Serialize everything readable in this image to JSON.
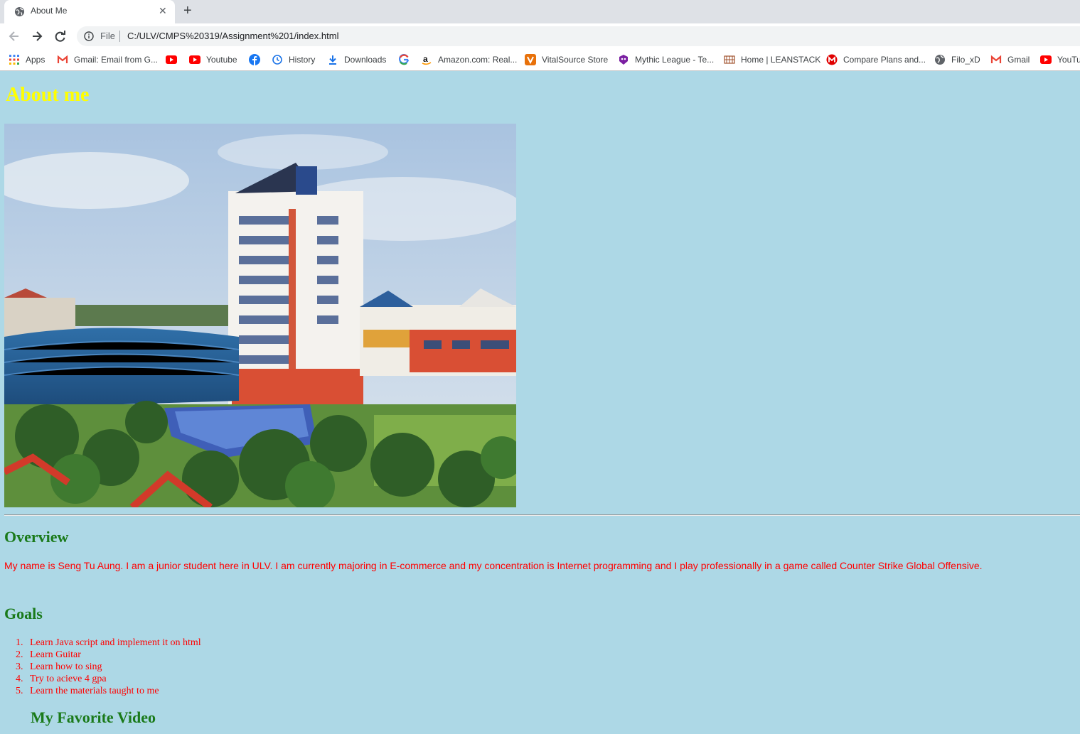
{
  "browser": {
    "tab_title": "About Me",
    "scheme_label": "File",
    "url": "C:/ULV/CMPS%20319/Assignment%201/index.html",
    "bookmarks": [
      {
        "label": "Apps",
        "icon": "apps-grid-icon"
      },
      {
        "label": "Gmail: Email from G...",
        "icon": "gmail-icon"
      },
      {
        "label": "",
        "icon": "youtube-icon"
      },
      {
        "label": "Youtube",
        "icon": "youtube-icon"
      },
      {
        "label": "",
        "icon": "facebook-icon"
      },
      {
        "label": "History",
        "icon": "history-icon"
      },
      {
        "label": "Downloads",
        "icon": "download-icon"
      },
      {
        "label": "",
        "icon": "google-icon"
      },
      {
        "label": "Amazon.com: Real...",
        "icon": "amazon-icon"
      },
      {
        "label": "VitalSource Store",
        "icon": "vitalsource-icon"
      },
      {
        "label": "Mythic League - Te...",
        "icon": "mythic-league-icon"
      },
      {
        "label": "Home | LEANSTACK",
        "icon": "leanstack-icon"
      },
      {
        "label": "Compare Plans and...",
        "icon": "compare-plans-icon"
      },
      {
        "label": "Filo_xD",
        "icon": "globe-icon"
      },
      {
        "label": "Gmail",
        "icon": "gmail-icon"
      },
      {
        "label": "YouTu",
        "icon": "youtube-icon"
      }
    ]
  },
  "page": {
    "title": "About me",
    "overview_heading": "Overview",
    "overview_text": "My name is Seng Tu Aung. I am a junior student here in ULV. I am currently majoring in E-commerce and my concentration is Internet programming and I play professionally in a game called Counter Strike Global Offensive.",
    "goals_heading": "Goals",
    "goals": [
      {
        "num": "1.",
        "text": "Learn Java script and implement it on html"
      },
      {
        "num": "2.",
        "text": "Learn Guitar"
      },
      {
        "num": "3.",
        "text": "Learn how to sing"
      },
      {
        "num": "4.",
        "text": "Try to acieve 4 gpa"
      },
      {
        "num": "5.",
        "text": "Learn the materials taught to me"
      }
    ],
    "video_heading": "My Favorite Video"
  },
  "colors": {
    "page_background": "#add8e6",
    "title_color": "#ffff00",
    "heading_color": "#1a7a1a",
    "text_color": "#ff0000"
  }
}
